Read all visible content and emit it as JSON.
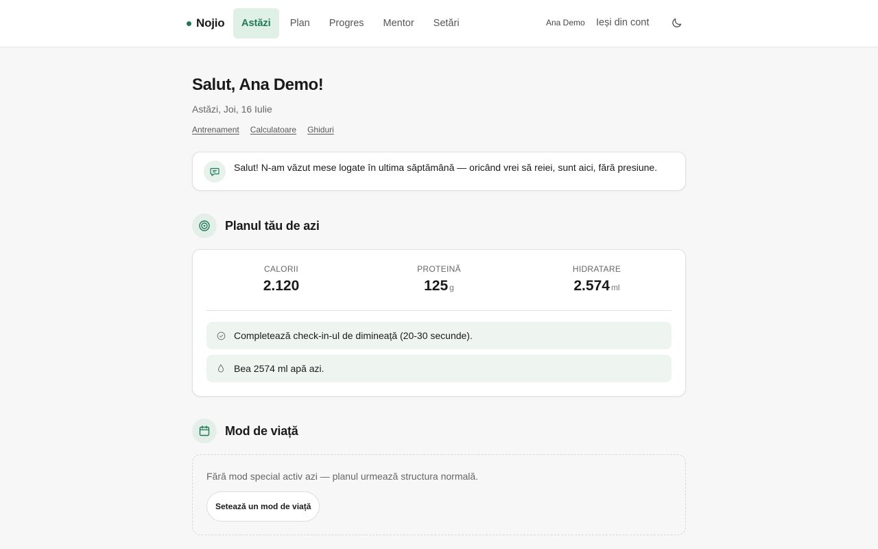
{
  "app": {
    "name": "Nojio"
  },
  "nav": {
    "items": [
      {
        "label": "Astăzi",
        "active": true
      },
      {
        "label": "Plan"
      },
      {
        "label": "Progres"
      },
      {
        "label": "Mentor"
      },
      {
        "label": "Setări"
      }
    ]
  },
  "user": {
    "name": "Ana Demo",
    "logout_label": "Ieși din cont",
    "theme_icon": "moon-icon"
  },
  "header": {
    "greeting": "Salut, Ana Demo!",
    "date": "Astăzi, Joi, 16 Iulie",
    "links": [
      "Antrenament",
      "Calculatoare",
      "Ghiduri"
    ]
  },
  "mentor": {
    "icon": "chat-icon",
    "message": "Salut! N-am văzut mese logate în ultima săptămână — oricând vrei să reiei, sunt aici, fără presiune."
  },
  "plan": {
    "icon": "target-icon",
    "title": "Planul tău de azi",
    "metrics": [
      {
        "label": "CALORII",
        "value": "2.120",
        "unit": ""
      },
      {
        "label": "PROTEINĂ",
        "value": "125",
        "unit": "g"
      },
      {
        "label": "HIDRATARE",
        "value": "2.574",
        "unit": "ml"
      }
    ],
    "tasks": [
      {
        "icon": "check-circle-icon",
        "text": "Completează check-in-ul de dimineață (20-30 secunde)."
      },
      {
        "icon": "water-drop-icon",
        "text": "Bea 2574 ml apă azi."
      }
    ]
  },
  "lifestyle": {
    "icon": "calendar-icon",
    "title": "Mod de viață",
    "text": "Fără mod special activ azi — planul urmează structura normală.",
    "button_label": "Setează un mod de viață"
  },
  "colors": {
    "accent": "#1b7a55",
    "accent_bg": "#dff0e7",
    "task_bg": "#eef5f1",
    "page_bg": "#f7f7f7"
  }
}
